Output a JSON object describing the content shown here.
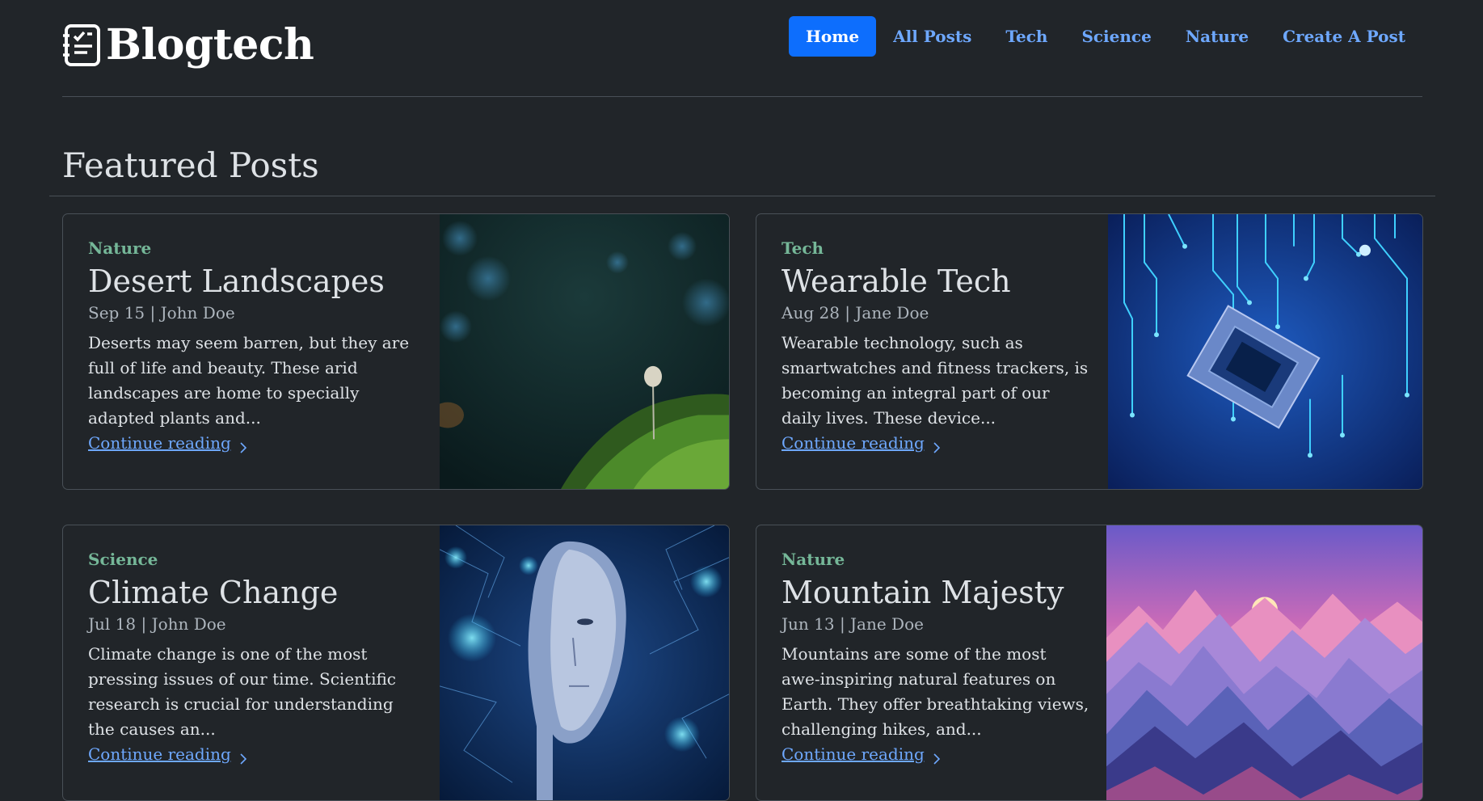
{
  "brand": {
    "name": "Blogtech",
    "icon": "journal-icon"
  },
  "nav": [
    {
      "label": "Home",
      "active": true
    },
    {
      "label": "All Posts",
      "active": false
    },
    {
      "label": "Tech",
      "active": false
    },
    {
      "label": "Science",
      "active": false
    },
    {
      "label": "Nature",
      "active": false
    },
    {
      "label": "Create A Post",
      "active": false
    }
  ],
  "featured": {
    "title": "Featured Posts",
    "posts": [
      {
        "category": "Nature",
        "title": "Desert Landscapes",
        "meta": "Sep 15 | John Doe",
        "excerpt_lines": [
          "Deserts may seem barren, but they are",
          "full of life and beauty. These arid",
          "landscapes are home to specially",
          "adapted plants and..."
        ],
        "link": "Continue reading",
        "image": "forest-mushroom-image"
      },
      {
        "category": "Tech",
        "title": "Wearable Tech",
        "meta": "Aug 28 | Jane Doe",
        "excerpt_lines": [
          "Wearable technology, such as",
          "smartwatches and fitness trackers, is",
          "becoming an integral part of our",
          "daily lives. These device..."
        ],
        "link": "Continue reading",
        "image": "circuit-chip-image"
      },
      {
        "category": "Science",
        "title": "Climate Change",
        "meta": "Jul 18 | John Doe",
        "excerpt_lines": [
          "Climate change is one of the most",
          "pressing issues of our time. Scientific",
          "research is crucial for understanding",
          "the causes an..."
        ],
        "link": "Continue reading",
        "image": "ai-face-image"
      },
      {
        "category": "Nature",
        "title": "Mountain Majesty",
        "meta": "Jun 13 | Jane Doe",
        "excerpt_lines": [
          "Mountains are some of the most",
          "awe-inspiring natural features on",
          "Earth. They offer breathtaking views,",
          "challenging hikes, and..."
        ],
        "link": "Continue reading",
        "image": "mountain-sunset-image"
      }
    ]
  },
  "colors": {
    "background": "#212529",
    "primary": "#0d6efd",
    "link": "#6ea8fe",
    "category": "#75b798",
    "border": "#495057"
  }
}
